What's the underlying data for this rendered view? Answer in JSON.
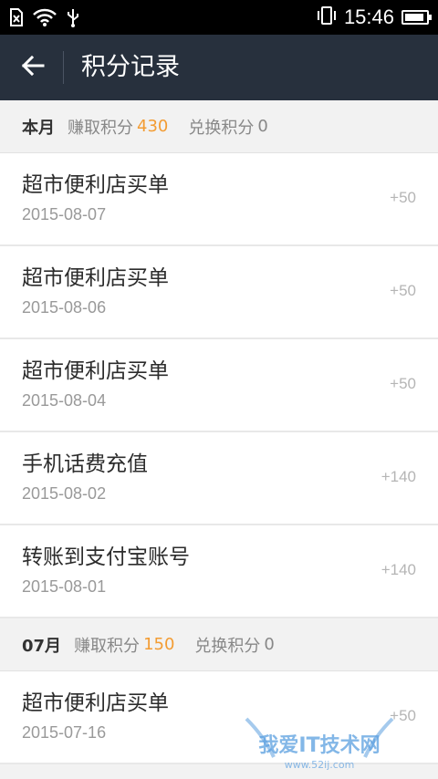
{
  "status_bar": {
    "time": "15:46",
    "battery_level": 0.9,
    "icons": [
      "sim-off-icon",
      "wifi-icon",
      "usb-icon",
      "vibrate-icon",
      "battery-icon"
    ]
  },
  "app_bar": {
    "title": "积分记录",
    "back_icon": "back-arrow-icon"
  },
  "sections": [
    {
      "month": "本月",
      "earn_label": "赚取积分",
      "earn_value": "430",
      "redeem_label": "兑换积分",
      "redeem_value": "0",
      "records": [
        {
          "name": "超市便利店买单",
          "date": "2015-08-07",
          "points": "+50"
        },
        {
          "name": "超市便利店买单",
          "date": "2015-08-06",
          "points": "+50"
        },
        {
          "name": "超市便利店买单",
          "date": "2015-08-04",
          "points": "+50"
        },
        {
          "name": "手机话费充值",
          "date": "2015-08-02",
          "points": "+140"
        },
        {
          "name": "转账到支付宝账号",
          "date": "2015-08-01",
          "points": "+140"
        }
      ]
    },
    {
      "month": "07月",
      "earn_label": "赚取积分",
      "earn_value": "150",
      "redeem_label": "兑换积分",
      "redeem_value": "0",
      "records": [
        {
          "name": "超市便利店买单",
          "date": "2015-07-16",
          "points": "+50"
        }
      ]
    }
  ],
  "watermark": {
    "text": "我爱IT技术网",
    "url_text": "www.52ij.com"
  },
  "colors": {
    "status_bar": "#000000",
    "app_bar": "#27303d",
    "accent_points": "#f39c33",
    "background": "#f2f2f2"
  }
}
